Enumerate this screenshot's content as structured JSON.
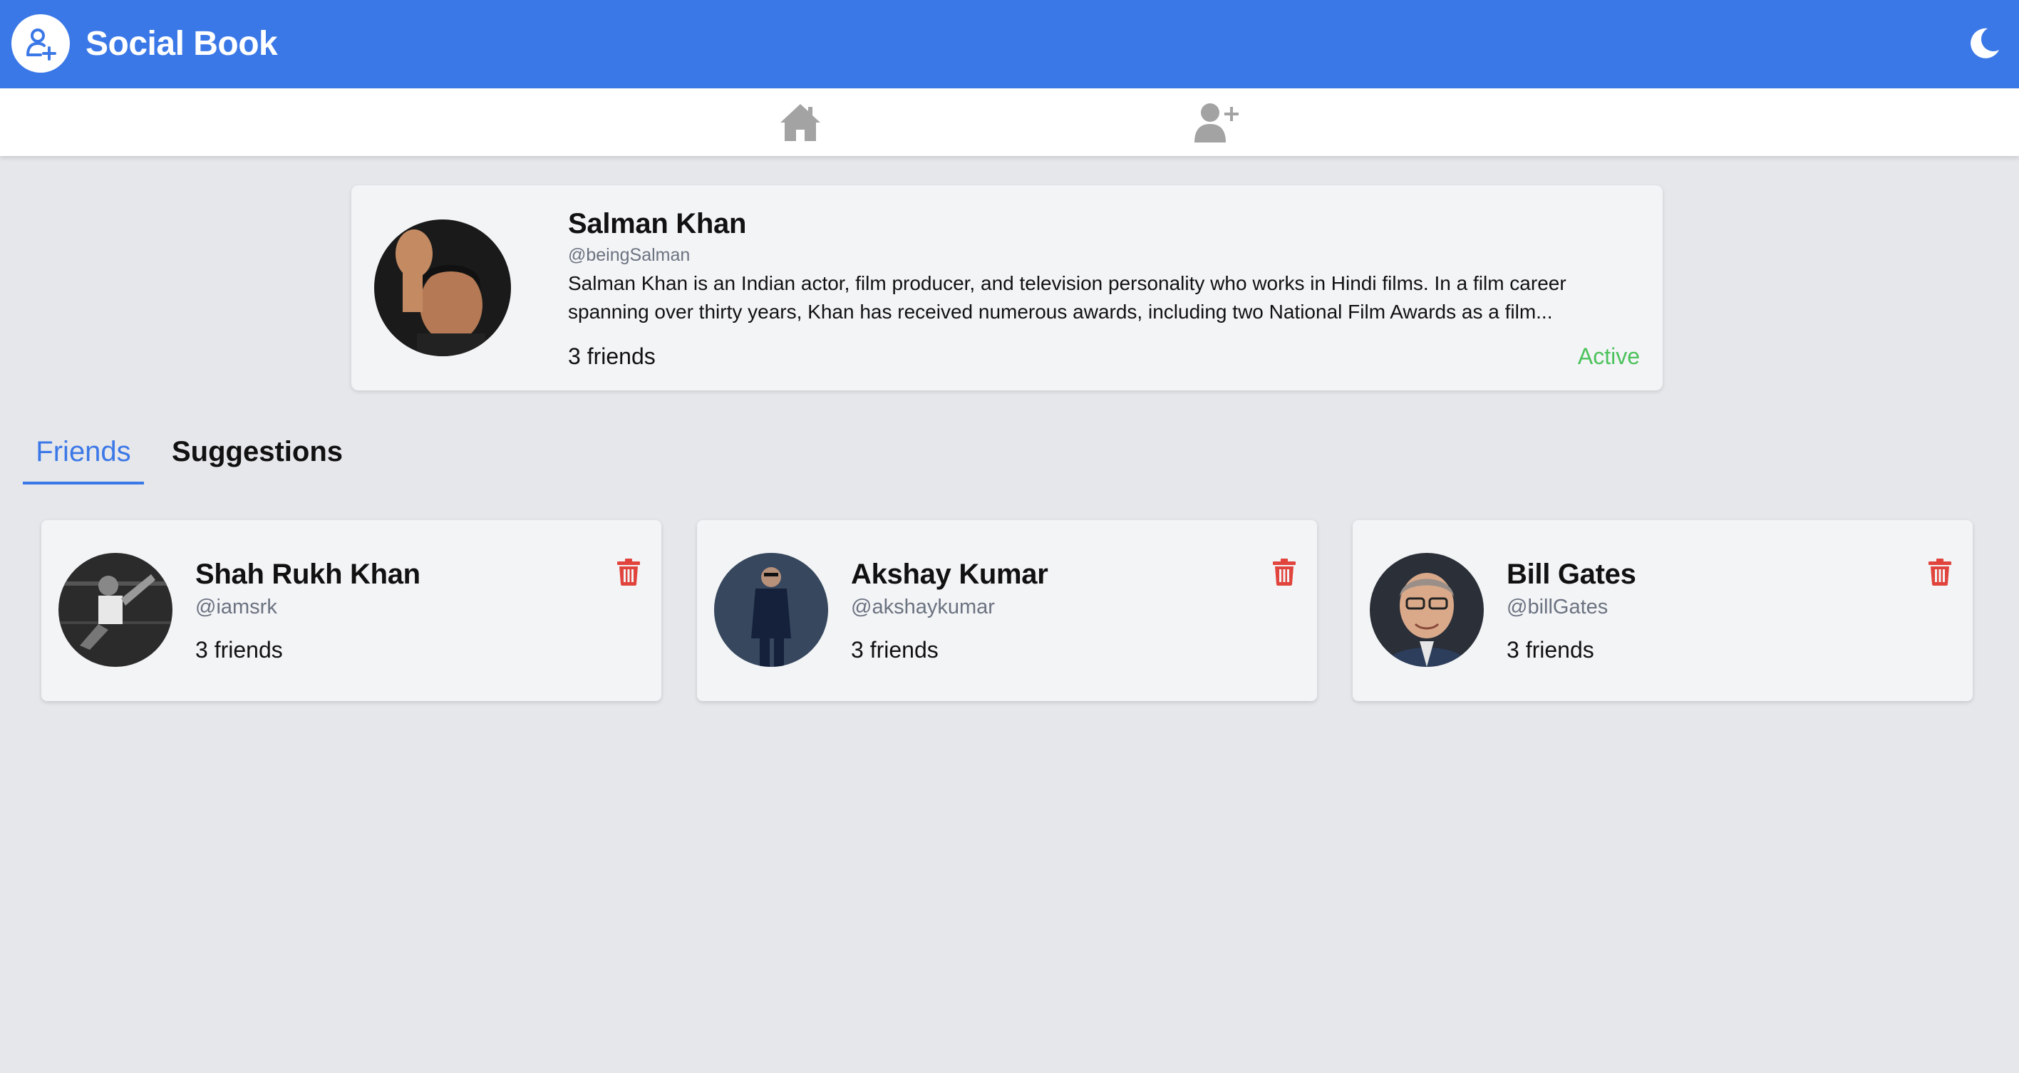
{
  "colors": {
    "brand": "#3b78e7",
    "active": "#4cc25c",
    "delete": "#e0443c",
    "muted": "#6b7280",
    "background": "#e5e7eb"
  },
  "header": {
    "title": "Social Book",
    "logo_icon": "add-user-icon",
    "theme_icon": "moon-icon"
  },
  "nav": {
    "items": [
      {
        "icon": "home-icon"
      },
      {
        "icon": "add-friend-icon"
      }
    ]
  },
  "profile": {
    "name": "Salman Khan",
    "handle": "@beingSalman",
    "bio": "Salman Khan is an Indian actor, film producer, and television personality who works in Hindi films. In a film career spanning over thirty years, Khan has received numerous awards, including two National Film Awards as a film...",
    "friends": "3 friends",
    "status": "Active"
  },
  "tabs": [
    {
      "label": "Friends",
      "selected": true
    },
    {
      "label": "Suggestions",
      "selected": false
    }
  ],
  "friends": [
    {
      "name": "Shah Rukh Khan",
      "handle": "@iamsrk",
      "friends": "3 friends"
    },
    {
      "name": "Akshay Kumar",
      "handle": "@akshaykumar",
      "friends": "3 friends"
    },
    {
      "name": "Bill Gates",
      "handle": "@billGates",
      "friends": "3 friends"
    }
  ]
}
